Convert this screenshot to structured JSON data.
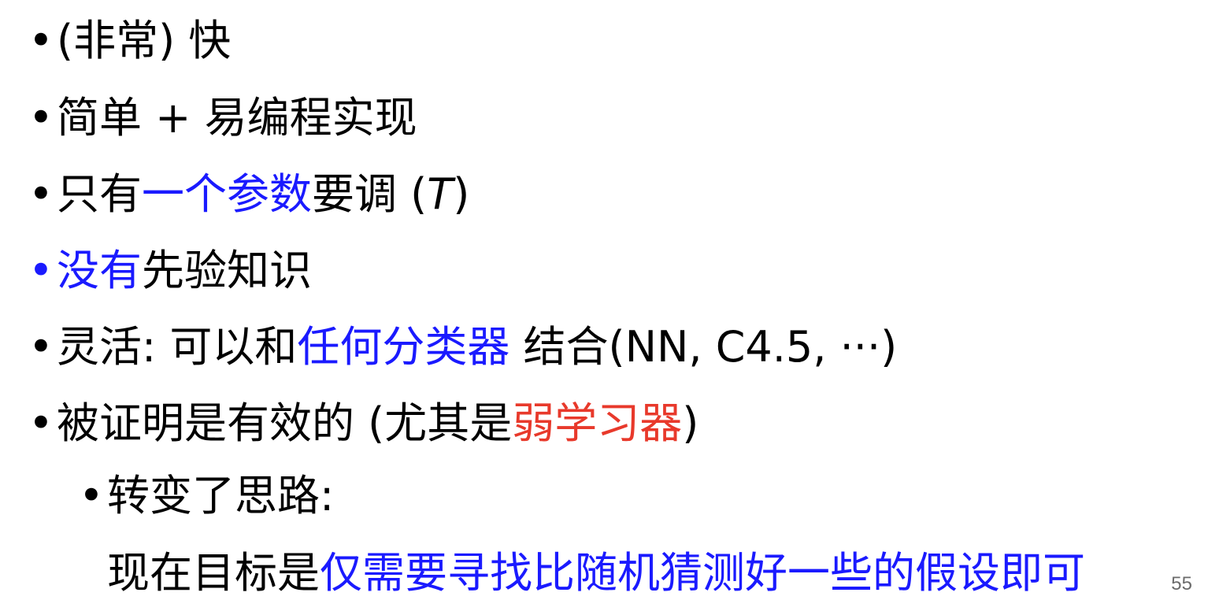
{
  "bullet_char": "•",
  "items": [
    {
      "segments": [
        {
          "text": "(非常) 快",
          "color": "black"
        }
      ]
    },
    {
      "segments": [
        {
          "text": "简单 + 易编程实现",
          "color": "black"
        }
      ]
    },
    {
      "segments": [
        {
          "text": "只有",
          "color": "black"
        },
        {
          "text": "一个参数",
          "color": "blue"
        },
        {
          "text": "要调 (",
          "color": "black"
        },
        {
          "text": "T",
          "color": "black",
          "italic": true
        },
        {
          "text": ")",
          "color": "black"
        }
      ]
    },
    {
      "segments": [
        {
          "text": "没有",
          "color": "blue"
        },
        {
          "text": "先验知识",
          "color": "black"
        }
      ]
    },
    {
      "segments": [
        {
          "text": "灵活: 可以和",
          "color": "black"
        },
        {
          "text": "任何分类器",
          "color": "blue"
        },
        {
          "text": " 结合(NN, C4.5, ···)",
          "color": "black"
        }
      ]
    },
    {
      "segments": [
        {
          "text": "被证明是有效的 (尤其是",
          "color": "black"
        },
        {
          "text": "弱学习器",
          "color": "red"
        },
        {
          "text": ")",
          "color": "black"
        }
      ]
    }
  ],
  "sub_item": {
    "text": "转变了思路:",
    "continuation": [
      {
        "text": "现在目标是",
        "color": "black"
      },
      {
        "text": "仅需要寻找比随机猜测好一些的假设即可",
        "color": "blue"
      }
    ]
  },
  "page_number": "55",
  "colors": {
    "blue": "#1a1aff",
    "red": "#e8392b",
    "black": "#000000"
  }
}
